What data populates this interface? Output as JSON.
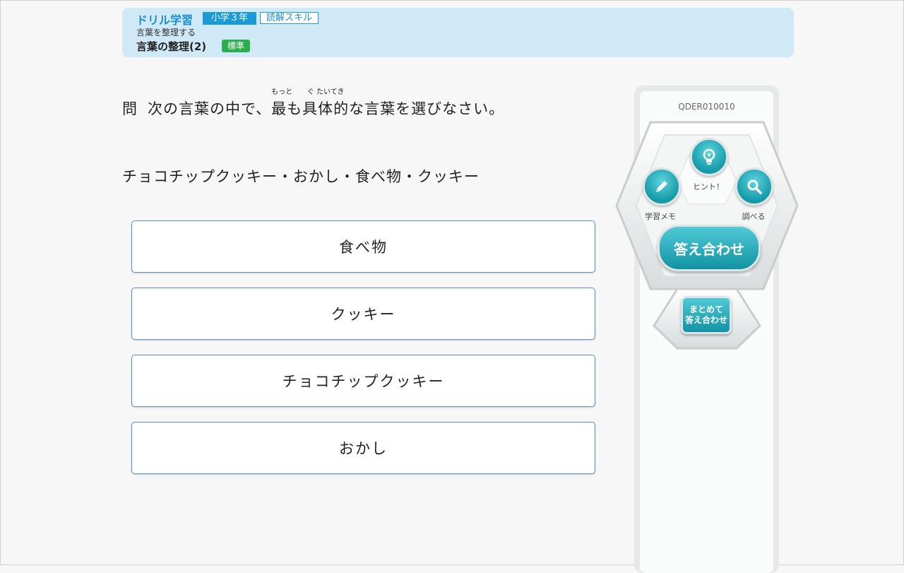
{
  "header": {
    "app_name": "ドリル学習",
    "grade": "小学３年",
    "skill": "読解スキル",
    "unit": "言葉を整理する",
    "title": "言葉の整理(2)",
    "level": "標準"
  },
  "question": {
    "mark": "問",
    "part1": "次の言葉の中で、",
    "word1": "最",
    "word1_ruby": "もっと",
    "part2": "も",
    "word2": "具体的",
    "word2_ruby": "ぐ たいてき",
    "part3": "な言葉を選びなさい。"
  },
  "word_list": "チョコチップクッキー・おかし・食べ物・クッキー",
  "choices": [
    "食べ物",
    "クッキー",
    "チョコチップクッキー",
    "おかし"
  ],
  "panel": {
    "code": "QDER010010",
    "hint_label": "ヒント！",
    "memo_label": "学習メモ",
    "lookup_label": "調べる",
    "answer_label": "答え合わせ",
    "batch_label_1": "まとめて",
    "batch_label_2": "答え合わせ"
  },
  "icons": {
    "hint": "lightbulb-icon",
    "memo": "pencil-icon",
    "lookup": "magnifier-icon"
  },
  "colors": {
    "accent": "#1a9ad6",
    "header_bg": "#cfeaf6",
    "level_badge": "#2cae4f",
    "tool_button": "#139aa8"
  }
}
